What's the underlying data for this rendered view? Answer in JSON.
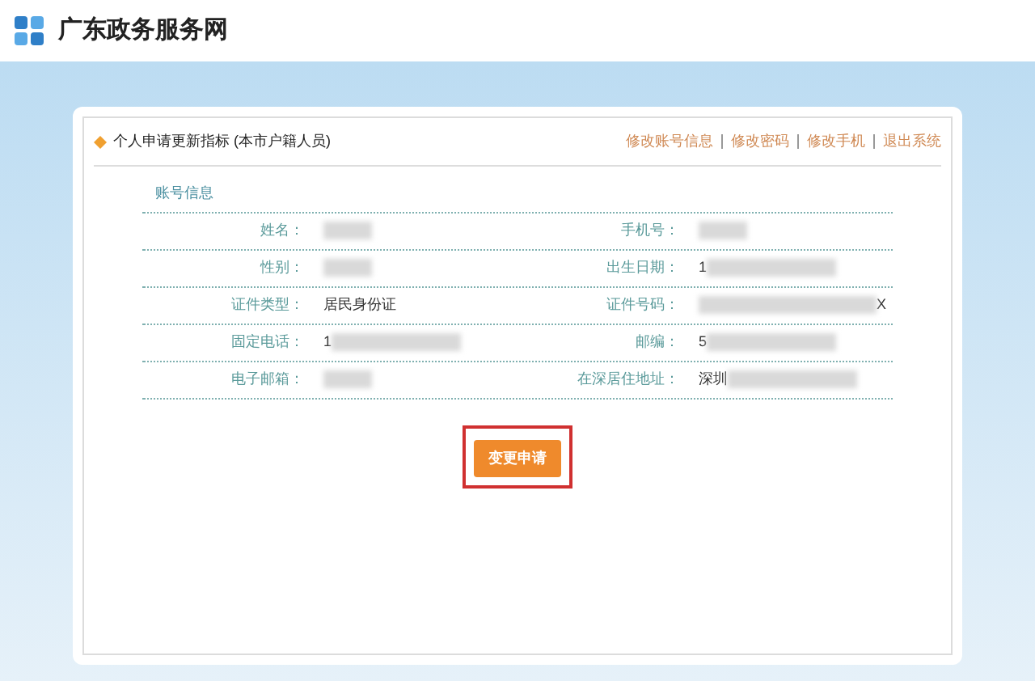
{
  "site": {
    "title": "广东政务服务网"
  },
  "panel": {
    "title": "个人申请更新指标 (本市户籍人员)",
    "links": [
      "修改账号信息",
      "修改密码",
      "修改手机",
      "退出系统"
    ]
  },
  "section": {
    "title": "账号信息"
  },
  "rows": [
    [
      {
        "label": "姓名：",
        "blurred_before": false,
        "blurred_after": true
      },
      {
        "label": "手机号：",
        "blurred_before": false,
        "blurred_after": true
      }
    ],
    [
      {
        "label": "性别：",
        "blurred_before": false,
        "blurred_after": true
      },
      {
        "label": "出生日期：",
        "value": "1",
        "blurred_before": false,
        "blurred_after": true
      }
    ],
    [
      {
        "label": "证件类型：",
        "value": "居民身份证",
        "blurred_before": false,
        "blurred_after": false
      },
      {
        "label": "证件号码：",
        "value": "X",
        "blurred_before": true,
        "blurred_after": false
      }
    ],
    [
      {
        "label": "固定电话：",
        "value": "1",
        "blurred_before": false,
        "blurred_after": true
      },
      {
        "label": "邮编：",
        "value": "5",
        "blurred_before": false,
        "blurred_after": true
      }
    ],
    [
      {
        "label": "电子邮箱：",
        "blurred_before": false,
        "blurred_after": true
      },
      {
        "label": "在深居住地址：",
        "value": "深圳",
        "blurred_before": false,
        "blurred_after": true
      }
    ]
  ],
  "button": {
    "label": "变更申请",
    "highlighted": true
  }
}
